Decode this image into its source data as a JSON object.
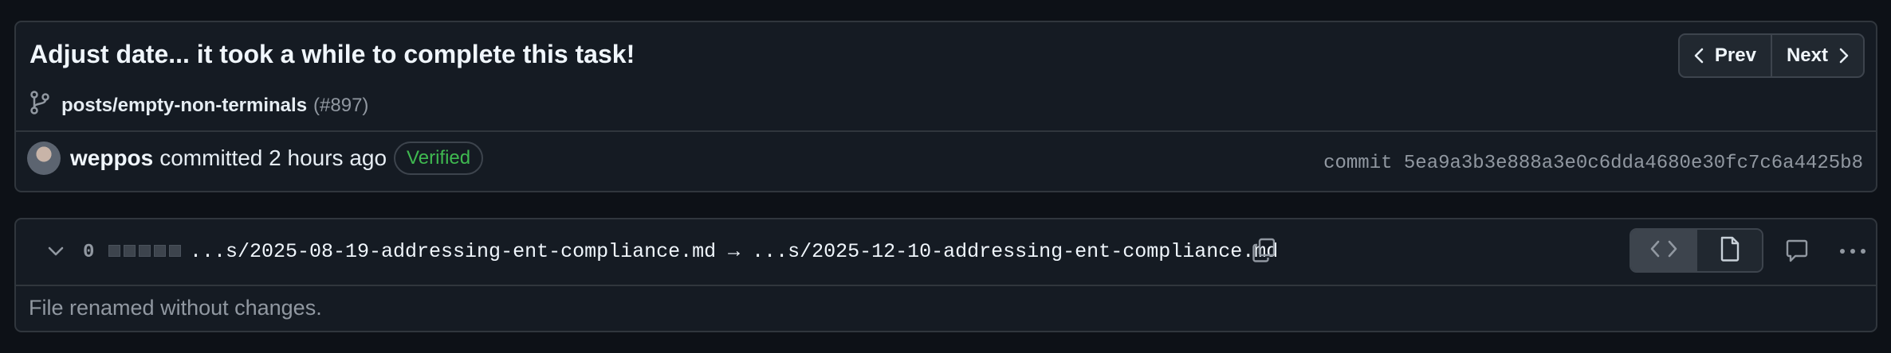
{
  "commit": {
    "title": "Adjust date... it took a while to complete this task!",
    "branch": "posts/empty-non-terminals",
    "pr_ref": "(#897)",
    "author": "weppos",
    "time": "committed 2 hours ago",
    "verified": "Verified",
    "sha": "commit 5ea9a3b3e888a3e0c6dda4680e30fc7c6a4425b8"
  },
  "nav": {
    "prev": "Prev",
    "next": "Next"
  },
  "file": {
    "change_count": "0",
    "diffstat_blocks": 5,
    "path": "...s/2025-08-19-addressing-ent-compliance.md → ...s/2025-12-10-addressing-ent-compliance.md",
    "notice": "File renamed without changes."
  },
  "colors": {
    "background": "#0d1117",
    "panel": "#151b23",
    "border": "#30363d",
    "verified_green": "#3fb950",
    "muted": "#9198a1"
  },
  "icons": [
    "git-branch-icon",
    "chevron-left-icon",
    "chevron-right-icon",
    "chevron-down-icon",
    "copy-icon",
    "code-icon",
    "file-icon",
    "comment-icon",
    "kebab-icon"
  ]
}
